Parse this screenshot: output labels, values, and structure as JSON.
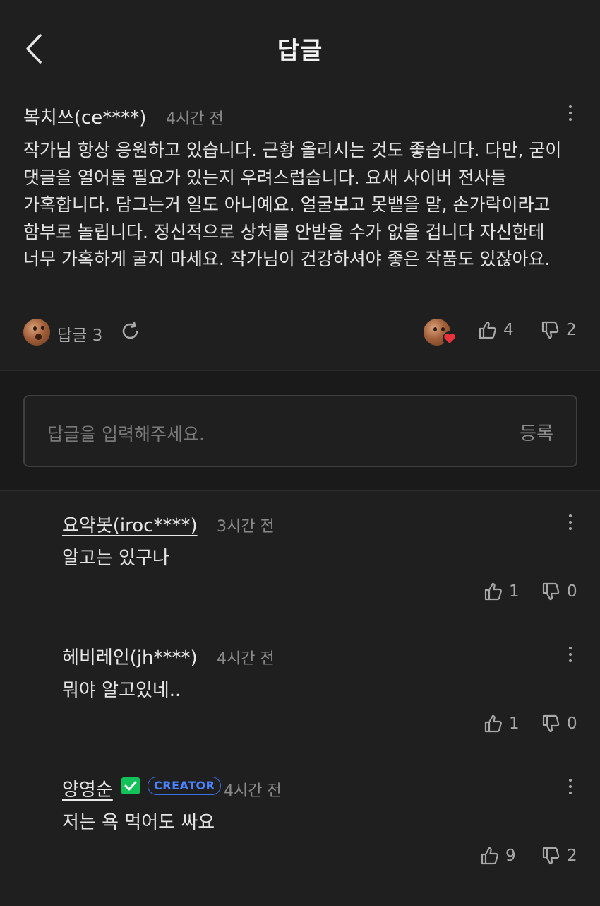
{
  "header": {
    "title": "답글"
  },
  "main_comment": {
    "author": "복치쓰(ce****)",
    "time": "4시간 전",
    "body": "작가님 항상 응원하고 있습니다. 근황 올리시는 것도 좋습니다. 다만, 굳이 댓글을 열어둘 필요가 있는지 우려스럽습니다. 요새 사이버 전사들 가혹합니다. 담그는거 일도 아니예요. 얼굴보고 못뱉을 말, 손가락이라고 함부로 놀립니다. 정신적으로 상처를 안받을 수가 없을 겁니다 자신한테 너무 가혹하게 굴지 마세요. 작가님이 건강하셔야 좋은 작품도 있잖아요.",
    "reply_label": "답글 3",
    "likes": "4",
    "dislikes": "2"
  },
  "reply_input": {
    "placeholder": "답글을 입력해주세요.",
    "submit_label": "등록"
  },
  "replies": [
    {
      "author": "요약봇(iroc****)",
      "time": "3시간 전",
      "body": "알고는 있구나",
      "likes": "1",
      "dislikes": "0"
    },
    {
      "author": "헤비레인(jh****)",
      "time": "4시간 전",
      "body": "뭐야 알고있네..",
      "likes": "1",
      "dislikes": "0"
    },
    {
      "author": "양영순",
      "badge": "CREATOR",
      "time": "4시간 전",
      "body": "저는 욕 먹어도 싸요",
      "likes": "9",
      "dislikes": "2"
    }
  ],
  "colors": {
    "background": "#1f1f1f",
    "creator_badge": "#4a82ff",
    "verified": "#14c25a",
    "heart": "#e8323c"
  }
}
